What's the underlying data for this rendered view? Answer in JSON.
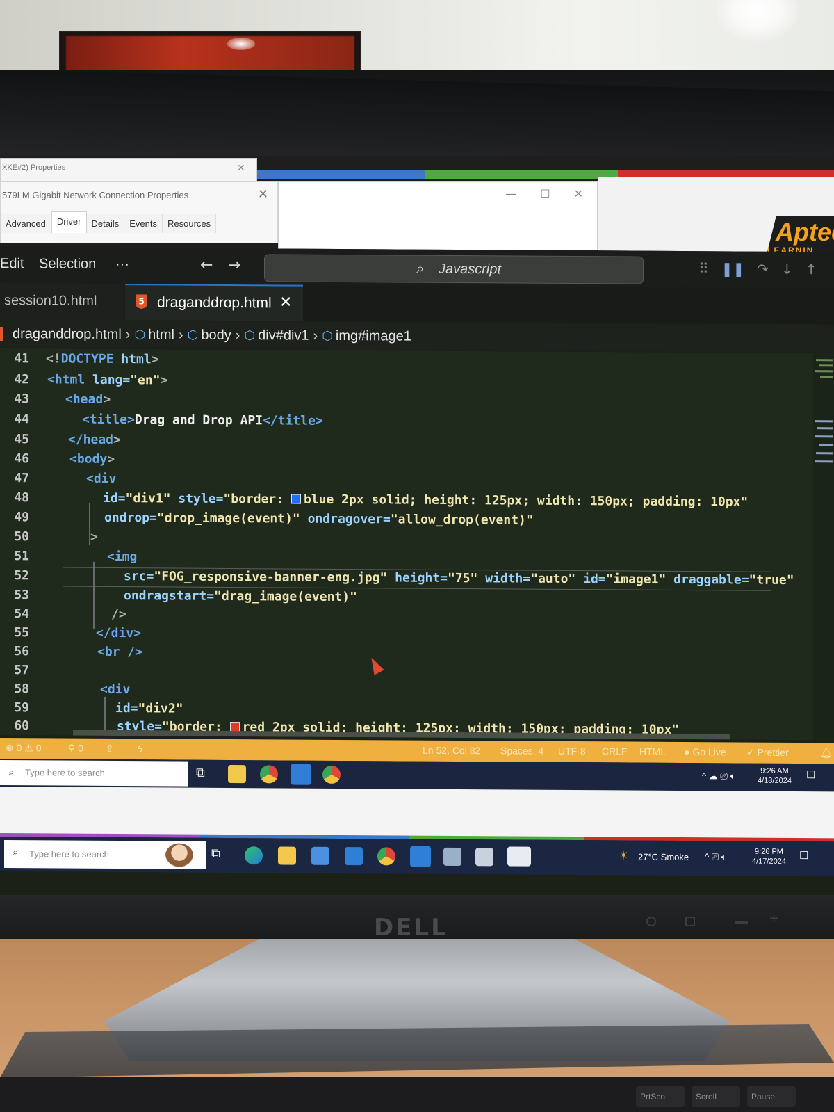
{
  "background_dialogs": {
    "back_title": "XKE#2) Properties",
    "main_title": "579LM Gigabit Network Connection Properties",
    "tabs": [
      "Advanced",
      "Driver",
      "Details",
      "Events",
      "Resources"
    ],
    "selected_tab": "Driver"
  },
  "brand_panel": {
    "logo_text": "Aptec",
    "sub_text": "LEARNIN"
  },
  "vscode": {
    "menu": [
      "Edit",
      "Selection",
      "···"
    ],
    "command_center": "Javascript",
    "tabs": [
      {
        "label": "session10.html",
        "active": false
      },
      {
        "label": "draganddrop.html",
        "active": true,
        "close": "✕"
      }
    ],
    "breadcrumbs": [
      "draganddrop.html",
      "html",
      "body",
      "div#div1",
      "img#image1"
    ],
    "line_numbers": [
      "41",
      "42",
      "43",
      "44",
      "45",
      "46",
      "47",
      "48",
      "49",
      "50",
      "51",
      "52",
      "53",
      "54",
      "55",
      "56",
      "57",
      "58",
      "59",
      "60"
    ],
    "code": {
      "l41": {
        "open": "<!",
        "kw": "DOCTYPE",
        "name": " html",
        "close": ">"
      },
      "l42": {
        "tag": "<html",
        "attr": " lang=",
        "val": "\"en\"",
        "close": ">"
      },
      "l43": {
        "tag": "<head",
        "close": ">"
      },
      "l44": {
        "tag": "<title>",
        "text": "Drag and Drop API",
        "end": "</title>"
      },
      "l45": {
        "tag": "</head",
        "close": ">"
      },
      "l46": {
        "tag": "<body",
        "close": ">"
      },
      "l47": {
        "tag": "<div"
      },
      "l48": {
        "attr1": "id=",
        "val1": "\"div1\"",
        "attr2": " style=",
        "val2a": "\"border: ",
        "val2b": "blue 2px solid; height: 125px; width: 150px; padding: 10px\""
      },
      "l49": {
        "attr1": "ondrop=",
        "val1": "\"drop_image(event)\"",
        "attr2": " ondragover=",
        "val2": "\"allow_drop(event)\""
      },
      "l50": {
        "close": ">"
      },
      "l51": {
        "tag": "<img"
      },
      "l52": {
        "attr1": "src=",
        "val1": "\"FOG_responsive-banner-eng.jpg\"",
        "attr2": " height=",
        "val2": "\"75\"",
        "attr3": " width=",
        "val3": "\"auto\"",
        "attr4": " id=",
        "val4": "\"image1\"",
        "attr5": " draggable=",
        "val5": "\"true\""
      },
      "l53": {
        "attr1": "ondragstart=",
        "val1": "\"drag_image(event)\""
      },
      "l54": {
        "close": "/>"
      },
      "l55": {
        "tag": "</div>"
      },
      "l56": {
        "tag": "<br />"
      },
      "l58": {
        "tag": "<div"
      },
      "l59": {
        "attr1": "id=",
        "val1": "\"div2\""
      },
      "l60": {
        "attr1": "style=",
        "val1a": "\"border: ",
        "val1b": "red 2px solid; height: 125px; width: 150px; padding: 10px\""
      }
    },
    "swatch_colors": {
      "blue": "#1f6fff",
      "red": "#e03a2a"
    },
    "statusbar": {
      "problems": "⊗ 0 ⚠ 0",
      "ports": "0",
      "position": "Ln 52, Col 82",
      "spaces": "Spaces: 4",
      "encoding": "UTF-8",
      "eol": "CRLF",
      "language": "HTML",
      "golive": "Go Live",
      "prettier": "✓ Prettier"
    }
  },
  "taskbar_remote": {
    "search_placeholder": "Type here to search",
    "time": "9:26 AM",
    "date": "4/18/2024"
  },
  "taskbar_local": {
    "search_placeholder": "Type here to search",
    "weather": "27°C  Smoke",
    "time": "9:26 PM",
    "date": "4/17/2024"
  },
  "monitor": {
    "brand": "DELL"
  },
  "keyboard": {
    "keys": [
      "PrtScn",
      "Scroll",
      "Pause"
    ]
  },
  "colors": {
    "statusbar": "#f0b040",
    "accent": "#2d74c8",
    "html5": "#e4552d"
  }
}
